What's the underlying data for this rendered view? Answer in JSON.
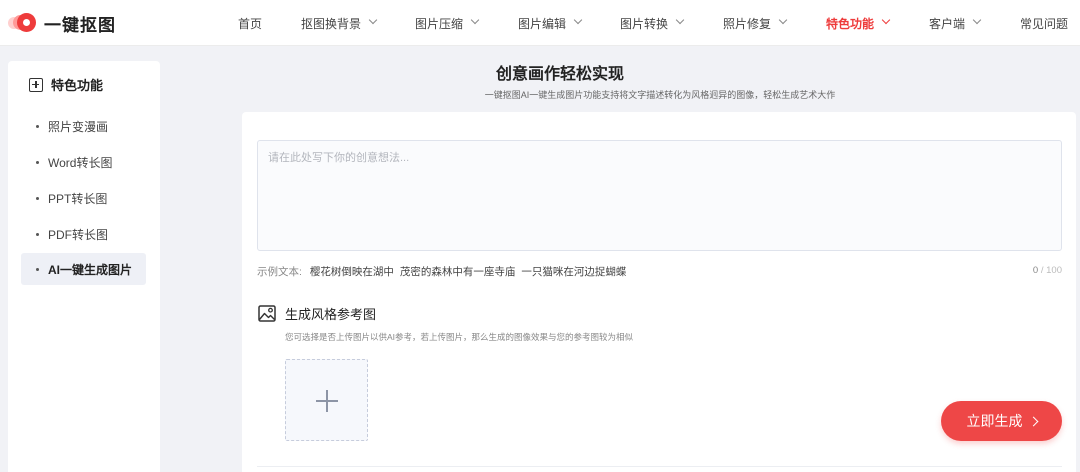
{
  "brand": {
    "name": "一键抠图",
    "accent": "#ee3b3b"
  },
  "nav": {
    "items": [
      {
        "label": "首页",
        "dropdown": false
      },
      {
        "label": "抠图换背景",
        "dropdown": true
      },
      {
        "label": "图片压缩",
        "dropdown": true
      },
      {
        "label": "图片编辑",
        "dropdown": true
      },
      {
        "label": "图片转换",
        "dropdown": true
      },
      {
        "label": "照片修复",
        "dropdown": true
      },
      {
        "label": "特色功能",
        "dropdown": true,
        "active": true
      },
      {
        "label": "客户端",
        "dropdown": true
      },
      {
        "label": "常见问题",
        "dropdown": false
      }
    ]
  },
  "sidebar": {
    "title": "特色功能",
    "items": [
      {
        "label": "照片变漫画"
      },
      {
        "label": "Word转长图"
      },
      {
        "label": "PPT转长图"
      },
      {
        "label": "PDF转长图"
      },
      {
        "label": "AI一键生成图片",
        "active": true
      }
    ]
  },
  "main": {
    "title": "创意画作轻松实现",
    "subtitle": "一键抠图AI一键生成图片功能支持将文字描述转化为风格迥异的图像，轻松生成艺术大作",
    "prompt": {
      "placeholder": "请在此处写下你的创意想法...",
      "value": ""
    },
    "examples": {
      "label": "示例文本:",
      "items": [
        "樱花树倒映在湖中",
        "茂密的森林中有一座寺庙",
        "一只猫咪在河边捉蝴蝶"
      ]
    },
    "counter": {
      "current": "0",
      "max": "/ 100"
    },
    "reference": {
      "title": "生成风格参考图",
      "description": "您可选择是否上传图片以供AI参考，若上传图片，那么生成的图像效果与您的参考图较为相似"
    },
    "generate_label": "立即生成"
  }
}
